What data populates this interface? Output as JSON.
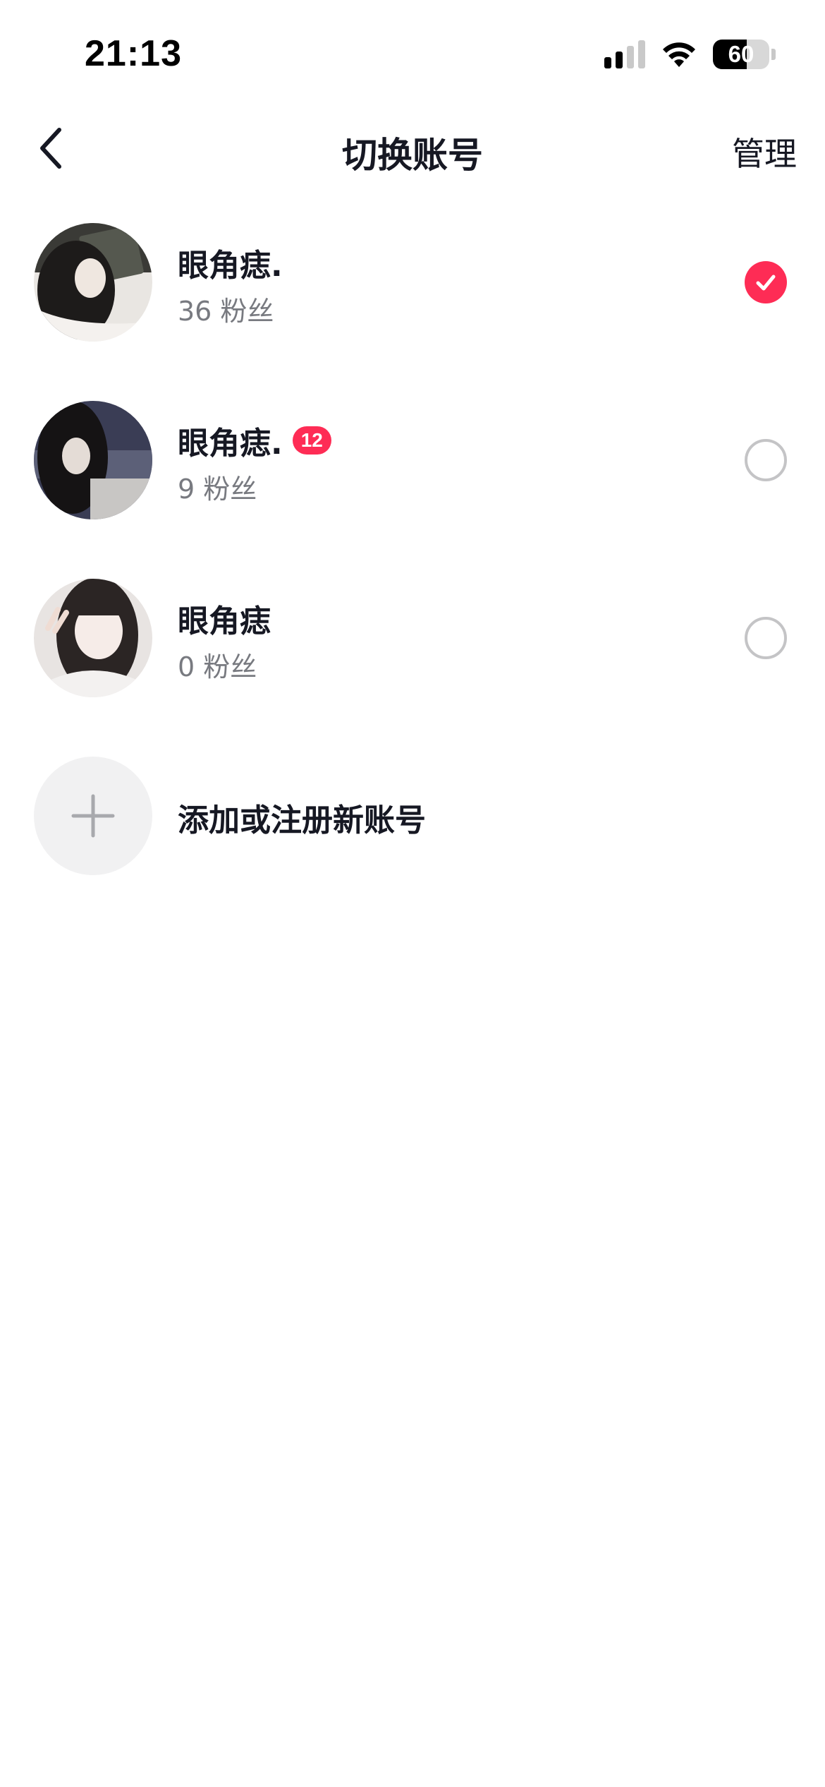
{
  "status_bar": {
    "time": "21:13",
    "battery_level": "60",
    "battery_fraction": 0.6,
    "signal_bars_filled": 2,
    "signal_bars_total": 4
  },
  "nav": {
    "title": "切换账号",
    "manage_label": "管理",
    "back_icon": "chevron-left-icon"
  },
  "accounts": [
    {
      "name": "眼角痣.",
      "followers": "36 粉丝",
      "badge": "",
      "selected": true
    },
    {
      "name": "眼角痣.",
      "followers": "9 粉丝",
      "badge": "12",
      "selected": false
    },
    {
      "name": "眼角痣",
      "followers": "0 粉丝",
      "badge": "",
      "selected": false
    }
  ],
  "add_account": {
    "label": "添加或注册新账号",
    "icon": "plus-icon"
  },
  "colors": {
    "accent": "#fe2c55",
    "text_primary": "#161823",
    "text_secondary": "#787a80",
    "radio_border": "#c4c4c6",
    "add_circle_bg": "#f1f1f2"
  }
}
